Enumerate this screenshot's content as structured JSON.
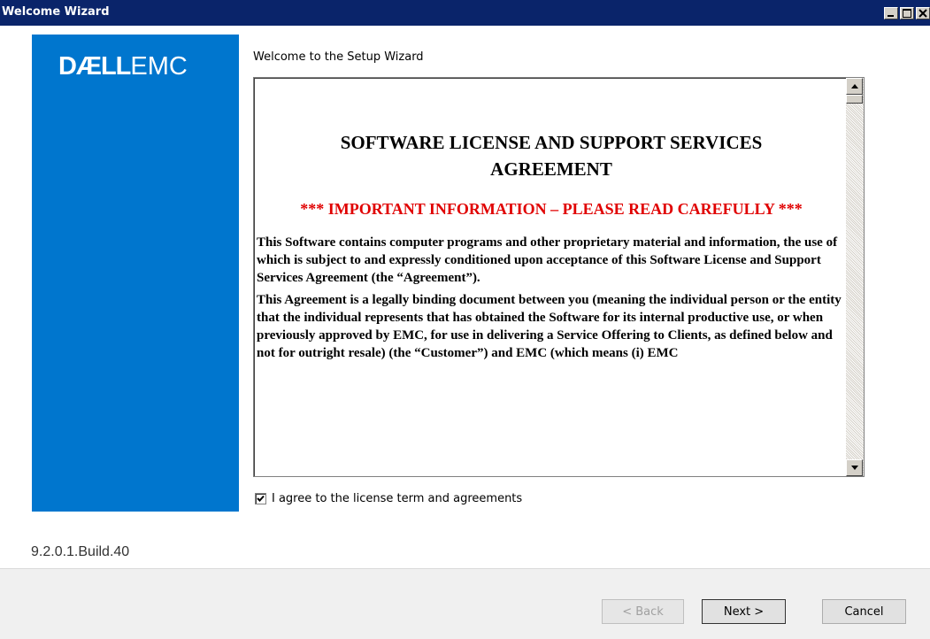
{
  "window": {
    "title": "Welcome Wizard"
  },
  "brand": {
    "logo_dell": "DÆLL",
    "logo_emc": "EMC",
    "panel_color": "#0076ce"
  },
  "wizard": {
    "heading": "Welcome to the Setup Wizard",
    "agree_label": "I agree to the license term and agreements",
    "agree_checked": true,
    "version": "9.2.0.1.Build.40"
  },
  "license": {
    "title": "SOFTWARE LICENSE AND SUPPORT SERVICES AGREEMENT",
    "important": "*** IMPORTANT INFORMATION – PLEASE READ CAREFULLY ***",
    "paragraphs": [
      "This Software contains computer programs and other proprietary material and information, the use of which is subject to and expressly conditioned upon acceptance of this Software License and Support Services Agreement (the “Agreement”).",
      "This Agreement is a legally binding document between you (meaning the individual person or the entity that the individual represents that has obtained the Software for its internal productive use, or when previously approved by EMC, for use in delivering a Service Offering to Clients, as defined below and not for outright resale) (the “Customer”) and EMC (which means (i) EMC"
    ]
  },
  "buttons": {
    "back": "< Back",
    "next": "Next >",
    "cancel": "Cancel",
    "back_enabled": false
  }
}
